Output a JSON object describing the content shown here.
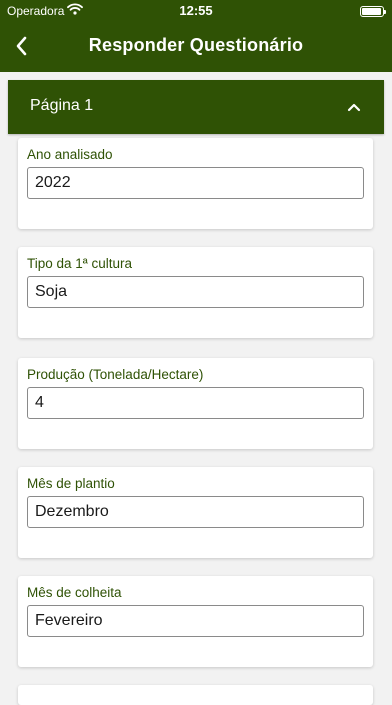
{
  "status_bar": {
    "carrier": "Operadora",
    "time": "12:55"
  },
  "nav": {
    "title": "Responder Questionário"
  },
  "section": {
    "label": "Página 1"
  },
  "fields": [
    {
      "label": "Ano analisado",
      "value": "2022"
    },
    {
      "label": "Tipo da 1ª cultura",
      "value": "Soja"
    },
    {
      "label": "Produção (Tonelada/Hectare)",
      "value": "4"
    },
    {
      "label": "Mês de plantio",
      "value": "Dezembro"
    },
    {
      "label": "Mês de colheita",
      "value": "Fevereiro"
    }
  ],
  "colors": {
    "brand": "#2f5205",
    "background": "#f2f2f2",
    "label": "#2f5205"
  }
}
